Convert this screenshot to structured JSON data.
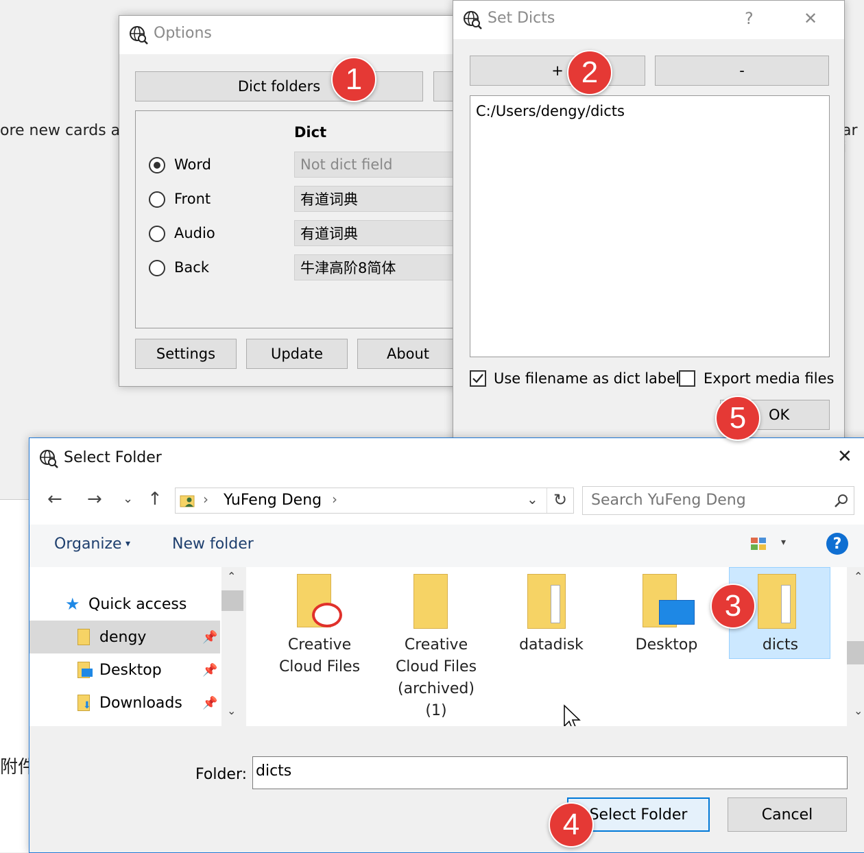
{
  "background": {
    "left_text": "ore new cards av",
    "right_text": "ar i",
    "bottom_left_text": "附件"
  },
  "options": {
    "title": "Options",
    "dict_folders_label": "Dict folders",
    "dict_header": "Dict",
    "radios": [
      {
        "label": "Word",
        "selected": true,
        "value": "Not dict field"
      },
      {
        "label": "Front",
        "selected": false,
        "value": "有道词典"
      },
      {
        "label": "Audio",
        "selected": false,
        "value": "有道词典"
      },
      {
        "label": "Back",
        "selected": false,
        "value": "牛津高阶8简体"
      }
    ],
    "buttons": {
      "settings": "Settings",
      "update": "Update",
      "about": "About"
    }
  },
  "set_dicts": {
    "title": "Set Dicts",
    "help": "?",
    "close": "✕",
    "add_label": "+",
    "remove_label": "-",
    "paths": [
      "C:/Users/dengy/dicts"
    ],
    "use_filename_label": "Use filename as dict label",
    "use_filename_checked": true,
    "export_media_label": "Export media files",
    "export_media_checked": false,
    "ok_label": "OK"
  },
  "select_folder": {
    "title": "Select Folder",
    "close": "✕",
    "breadcrumb": "YuFeng Deng",
    "search_placeholder": "Search YuFeng Deng",
    "organize_label": "Organize",
    "new_folder_label": "New folder",
    "help": "?",
    "nav": {
      "quick_access": "Quick access",
      "items": [
        "dengy",
        "Desktop",
        "Downloads"
      ]
    },
    "folders": [
      {
        "name": "Creative\nCloud Files",
        "icon": "creative-cloud-folder-icon"
      },
      {
        "name": "Creative\nCloud Files\n(archived)\n(1)",
        "icon": "folder-icon"
      },
      {
        "name": "datadisk",
        "icon": "documents-folder-icon"
      },
      {
        "name": "Desktop",
        "icon": "desktop-folder-icon"
      },
      {
        "name": "dicts",
        "icon": "documents-folder-icon"
      }
    ],
    "folder_field_label": "Folder:",
    "folder_value": "dicts",
    "select_label": "Select Folder",
    "cancel_label": "Cancel"
  },
  "badges": [
    "1",
    "2",
    "3",
    "4",
    "5"
  ],
  "colors": {
    "badge": "#e53935",
    "selected": "#cce8ff",
    "accent": "#0078d7"
  }
}
